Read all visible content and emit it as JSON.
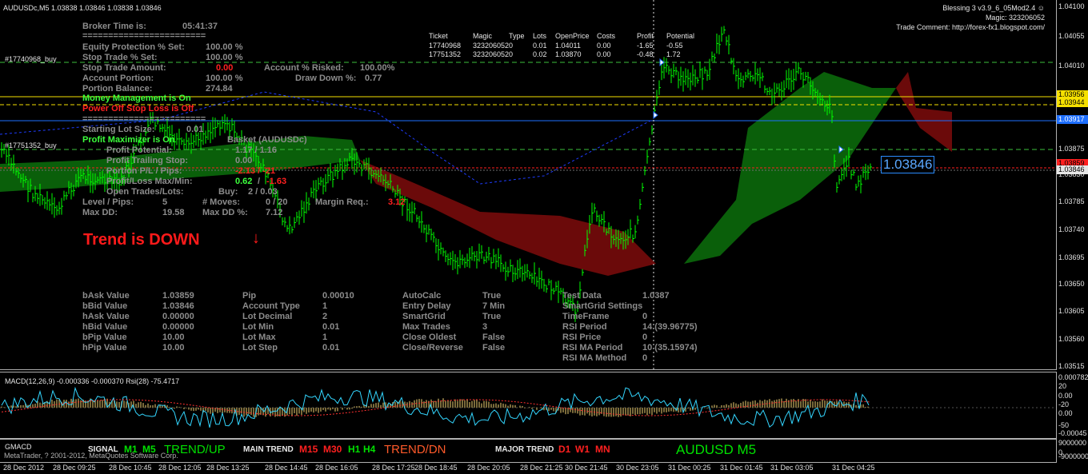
{
  "window": {
    "symbol_line": "AUDUSDc,M5  1.03838 1.03846 1.03838 1.03846",
    "ea_name": "Blessing 3 v3.9_6_05Mod2.4 ☺",
    "magic": "Magic: 323206052",
    "trade_comment": "Trade Comment: http://forex-fx1.blogspot.com/",
    "current_price_box": "1.03846"
  },
  "price_axis": [
    "1.04100",
    "1.04055",
    "1.04010",
    "1.03875",
    "1.03830",
    "1.03785",
    "1.03740",
    "1.03695",
    "1.03650",
    "1.03605",
    "1.03560",
    "1.03515"
  ],
  "price_tags": [
    {
      "label": "1.03956",
      "bg": "#f5e000"
    },
    {
      "label": "1.03944",
      "bg": "#f5e000"
    },
    {
      "label": "1.03917",
      "bg": "#1e6fff"
    },
    {
      "label": "1.03859",
      "bg": "#ff2020"
    },
    {
      "label": "1.03846",
      "bg": "#e6e6e6"
    }
  ],
  "line_labels": {
    "buy1": "#17740968_buy",
    "buy2": "#17751352_buy"
  },
  "broker": {
    "time_label": "Broker Time is:",
    "time_value": "05:41:37",
    "separator": "========================",
    "eq_prot_label": "Equity Protection % Set:",
    "eq_prot_value": "100.00 %",
    "stop_pct_label": "Stop Trade % Set:",
    "stop_pct_value": "100.00 %",
    "stop_amt_label": "Stop Trade Amount:",
    "stop_amt_value": "0.00",
    "acct_risk_label": "Account % Risked:",
    "acct_risk_value": "100.00%",
    "acct_portion_label": "Account Portion:",
    "acct_portion_value": "100.00 %",
    "drawdown_label": "Draw Down %:",
    "drawdown_value": "0.77",
    "portion_bal_label": "Portion Balance:",
    "portion_bal_value": "274.84",
    "money_mgmt": "Money Management is On",
    "power_off": "Power Off Stop Loss is Off",
    "separator2": "========================",
    "start_lot_label": "Starting Lot Size:",
    "start_lot_value": "0.01",
    "profit_max": "Profit Maximizer is On",
    "basket_label": "Basket (AUDUSDc)",
    "profit_pot_label": "Profit Potential:",
    "profit_pot_value": "1.17 / 1.16",
    "profit_trail_label": "Profit Trailing Stop:",
    "profit_trail_value": "0.00",
    "portion_pl_label": "Portion P/L / Pips:",
    "portion_pl_value": "-2.13 / -21",
    "profit_loss_label": "Profit/Loss Max/Min:",
    "profit_loss_a": "0.62",
    "profit_loss_b": "-1.63",
    "open_trades_label": "Open Trades/Lots:",
    "open_trades_buy": "Buy:",
    "open_trades_value": "2 / 0.03",
    "level_label": "Level / Pips:",
    "level_value": "5",
    "moves_label": "# Moves:",
    "moves_value": "0 / 20",
    "margin_label": "Margin Req.:",
    "margin_value": "3.12",
    "maxdd_label": "Max DD:",
    "maxdd_value": "19.58",
    "maxdd_pct_label": "Max DD %:",
    "maxdd_pct_value": "7.12"
  },
  "trend_text": "Trend is DOWN",
  "trend_arrow": "↓",
  "orders": {
    "headers": [
      "Ticket",
      "Magic",
      "Type",
      "Lots",
      "OpenPrice",
      "Costs",
      "Profit",
      "Potential"
    ],
    "rows": [
      [
        "17740968",
        "323206052",
        "0",
        "0.01",
        "1.04011",
        "0.00",
        "-1.65",
        "-0.55"
      ],
      [
        "17751352",
        "323206052",
        "0",
        "0.02",
        "1.03870",
        "0.00",
        "-0.48",
        "1.72"
      ]
    ]
  },
  "info_table": [
    [
      "bAsk Value",
      "1.03859",
      "Pip",
      "0.00010",
      "AutoCalc",
      "True",
      "Test Data",
      "1.0387"
    ],
    [
      "bBid Value",
      "1.03846",
      "Account Type",
      "1",
      "Entry Delay",
      "7 Min",
      "SmartGrid Settings",
      ""
    ],
    [
      "hAsk Value",
      "0.00000",
      "Lot Decimal",
      "2",
      "SmartGrid",
      "True",
      "TimeFrame",
      "0"
    ],
    [
      "hBid Value",
      "0.00000",
      "Lot Min",
      "0.01",
      "Max Trades",
      "3",
      "RSI Period",
      "14 (39.96775)"
    ],
    [
      "bPip Value",
      "10.00",
      "Lot Max",
      "1",
      "Close Oldest",
      "False",
      "RSI Price",
      "0"
    ],
    [
      "hPip Value",
      "10.00",
      "Lot Step",
      "0.01",
      "Close/Reverse",
      "False",
      "RSI MA Period",
      "10 (35.15974)"
    ],
    [
      "",
      "",
      "",
      "",
      "",
      "",
      "RSI MA Method",
      "0"
    ]
  ],
  "macd": {
    "label": "MACD(12,26,9) -0.000336 -0.000370  Rsi(28) -75.4717",
    "axis": [
      "0.000782",
      "20",
      "0.00",
      "0.00",
      "-20",
      "-50",
      "-0.00045"
    ]
  },
  "gmacd": {
    "label": "GMACD",
    "signal": "SIGNAL",
    "signal_tfs": [
      "M1",
      "M5"
    ],
    "signal_trend": "TREND/UP",
    "main": "MAIN TREND",
    "main_tfs": [
      "M15",
      "M30",
      "H1",
      "H4"
    ],
    "main_trend": "TREND/DN",
    "major": "MAJOR TREND",
    "major_tfs": [
      "D1",
      "W1",
      "MN"
    ],
    "pair": "AUDUSD M5",
    "copyright": "MetaTrader, ? 2001-2012, MetaQuotes Software Corp.",
    "axis": [
      "9000000",
      "0",
      "-9000000"
    ]
  },
  "time_axis": [
    "28 Dec 2012",
    "28 Dec 09:25",
    "28 Dec 10:45",
    "28 Dec 12:05",
    "28 Dec 13:25",
    "28 Dec 14:45",
    "28 Dec 16:05",
    "28 Dec 17:25",
    "28 Dec 18:45",
    "28 Dec 20:05",
    "28 Dec 21:25",
    "30 Dec 21:45",
    "30 Dec 23:05",
    "31 Dec 00:25",
    "31 Dec 01:45",
    "31 Dec 03:05",
    "31 Dec 04:25"
  ],
  "colors": {
    "bull": "#00ff00",
    "cloud_up": "#0a5f0a",
    "cloud_dn": "#6b0a0a",
    "trend_down": "#ff1a1a",
    "label_grey": "#8c8c8c"
  }
}
